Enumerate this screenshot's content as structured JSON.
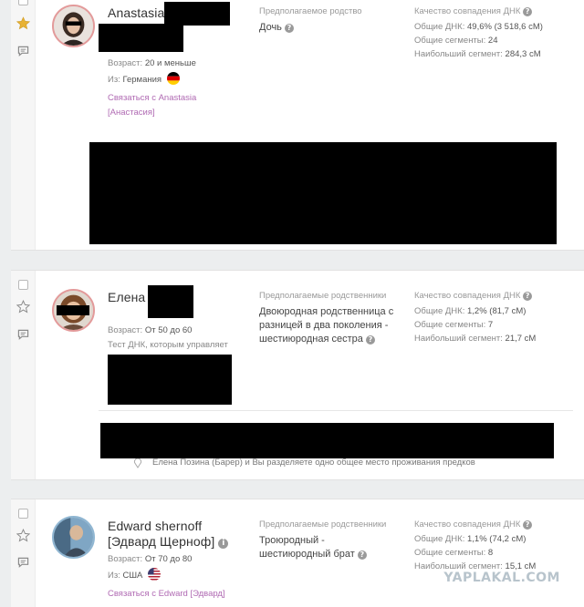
{
  "matches": [
    {
      "name": "Anastasia",
      "age_label": "Возраст:",
      "age_value": "20 и меньше",
      "from_label": "Из:",
      "from_value": "Германия",
      "flag": "germany-flag",
      "contact_link": "Связаться с Anastasia",
      "contact_link_translit": "[Анастасия]",
      "relationship_header": "Предполагаемое родство",
      "relationship": "Дочь",
      "quality_header": "Качество совпадения ДНК",
      "shared_dna_label": "Общие ДНК:",
      "shared_dna_value": "49,6% (3 518,6 сМ)",
      "segments_label": "Общие сегменты:",
      "segments_value": "24",
      "largest_label": "Наибольший сегмент:",
      "largest_value": "284,3 сМ",
      "starred": true
    },
    {
      "name": "Елена",
      "age_label": "Возраст:",
      "age_value": "От 50 до 60",
      "managed_label": "Тест ДНК, которым управляет",
      "relationship_header": "Предполагаемые родственники",
      "relationship": "Двоюродная родственница с разницей в два поколения - шестиюродная сестра",
      "quality_header": "Качество совпадения ДНК",
      "shared_dna_label": "Общие ДНК:",
      "shared_dna_value": "1,2% (81,7 сМ)",
      "segments_label": "Общие сегменты:",
      "segments_value": "7",
      "largest_label": "Наибольший сегмент:",
      "largest_value": "21,7 сМ",
      "ancestral_place": "Елена Позина (Барер) и Вы разделяете одно общее место проживания предков",
      "starred": false
    },
    {
      "name": "Edward shernoff",
      "name_translit": "[Эдвард Щернoф]",
      "age_label": "Возраст:",
      "age_value": "От 70 до 80",
      "from_label": "Из:",
      "from_value": "США",
      "flag": "usa-flag",
      "contact_link": "Связаться с Edward [Эдвард]",
      "relationship_header": "Предполагаемые родственники",
      "relationship": "Троюродный - шестиюродный брат",
      "quality_header": "Качество совпадения ДНК",
      "shared_dna_label": "Общие ДНК:",
      "shared_dna_value": "1,1% (74,2 сМ)",
      "segments_label": "Общие сегменты:",
      "segments_value": "8",
      "largest_label": "Наибольший сегмент:",
      "largest_value": "15,1 сМ",
      "starred": false
    }
  ],
  "watermark": "YAPLAKAL.COM",
  "colors": {
    "link": "#b06ab3",
    "star_active": "#e8b234",
    "background": "#eceeef"
  }
}
